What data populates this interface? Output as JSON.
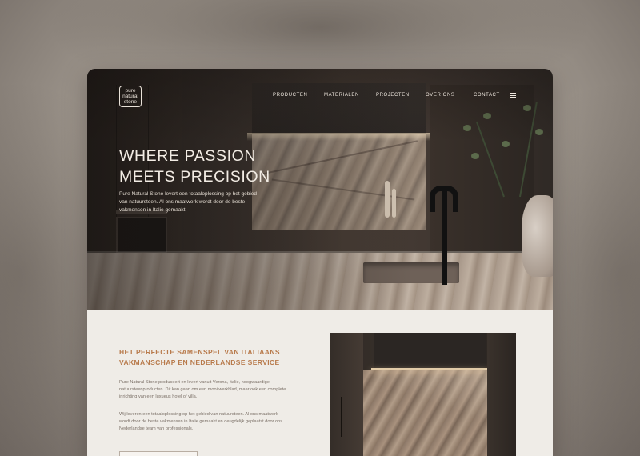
{
  "site": {
    "logo": [
      "pure",
      "natural",
      "stone"
    ]
  },
  "nav": {
    "items": [
      "PRODUCTEN",
      "MATERIALEN",
      "PROJECTEN",
      "OVER ONS",
      "CONTACT"
    ],
    "menu_icon": "hamburger-icon"
  },
  "hero": {
    "headline_line1": "WHERE PASSION",
    "headline_line2": "MEETS PRECISION",
    "text": "Pure Natural Stone levert een totaaloplossing op het gebied van natuursteen. Al ons maatwerk wordt door de beste vakmensen in Italie gemaakt."
  },
  "intro": {
    "heading": "HET PERFECTE SAMENSPEL VAN ITALIAANS VAKMANSCHAP EN NEDERLANDSE SERVICE",
    "paragraph1": "Pure Natural Stone produceert en levert vanuit Verona, Italie, hoogwaardige natuursteenproducten. Dit kan gaan om een mooi werkblad, maar ook een complete inrichting van een luxueus hotel of villa.",
    "paragraph2": "Wij leveren een totaaloplossing op het gebied van natuursteen. Al ons maatwerk wordt door de beste vakmensen in Italie gemaakt en deugdelijk geplaatst door ons Nederlandse team van professionals."
  },
  "colors": {
    "accent": "#b87a4b",
    "hero_text": "#f2ece4",
    "content_bg": "#efece7"
  }
}
